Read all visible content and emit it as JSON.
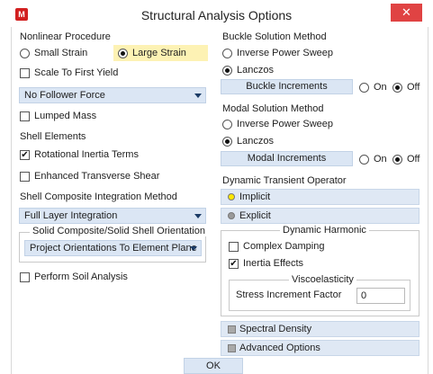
{
  "window": {
    "title": "Structural Analysis Options",
    "icon_label": "M",
    "close_glyph": "✕"
  },
  "nonlinear": {
    "heading": "Nonlinear Procedure",
    "small_strain": "Small Strain",
    "large_strain": "Large Strain",
    "selected": "Large Strain",
    "scale_to_first_yield": "Scale To First Yield",
    "scale_to_first_yield_checked": false
  },
  "follower_force": {
    "value": "No Follower Force"
  },
  "lumped_mass": {
    "label": "Lumped Mass",
    "checked": false
  },
  "shell": {
    "heading": "Shell Elements",
    "rotational_inertia": "Rotational Inertia Terms",
    "rotational_inertia_checked": true,
    "enhanced_shear": "Enhanced Transverse Shear",
    "enhanced_shear_checked": false
  },
  "shell_composite": {
    "heading": "Shell Composite Integration Method",
    "value": "Full Layer Integration"
  },
  "solid_orientation": {
    "group_title": "Solid Composite/Solid Shell Orientation",
    "value": "Project Orientations To Element Plane"
  },
  "soil": {
    "label": "Perform Soil Analysis",
    "checked": false
  },
  "buckle": {
    "heading": "Buckle Solution Method",
    "inverse_power": "Inverse Power Sweep",
    "lanczos": "Lanczos",
    "selected": "Lanczos",
    "increments_button": "Buckle Increments",
    "on": "On",
    "off": "Off",
    "increments_state": "Off"
  },
  "modal": {
    "heading": "Modal Solution Method",
    "inverse_power": "Inverse Power Sweep",
    "lanczos": "Lanczos",
    "selected": "Lanczos",
    "increments_button": "Modal Increments",
    "on": "On",
    "off": "Off",
    "increments_state": "Off"
  },
  "dynamic_transient": {
    "heading": "Dynamic Transient Operator",
    "implicit": "Implicit",
    "explicit": "Explicit",
    "selected": "Implicit",
    "implicit_color": "#ffe800"
  },
  "dynamic_harmonic": {
    "group_title": "Dynamic Harmonic",
    "complex_damping": "Complex Damping",
    "complex_damping_checked": false,
    "inertia_effects": "Inertia Effects",
    "inertia_effects_checked": true,
    "visco_title": "Viscoelasticity",
    "stress_increment_label": "Stress Increment Factor",
    "stress_increment_value": "0"
  },
  "spectral_density": "Spectral Density",
  "advanced_options": "Advanced Options",
  "ok_button": "OK",
  "colors": {
    "accent_bar": "#dbe6f4",
    "selected_highlight": "#fdf2b4",
    "close_red": "#e04343"
  }
}
